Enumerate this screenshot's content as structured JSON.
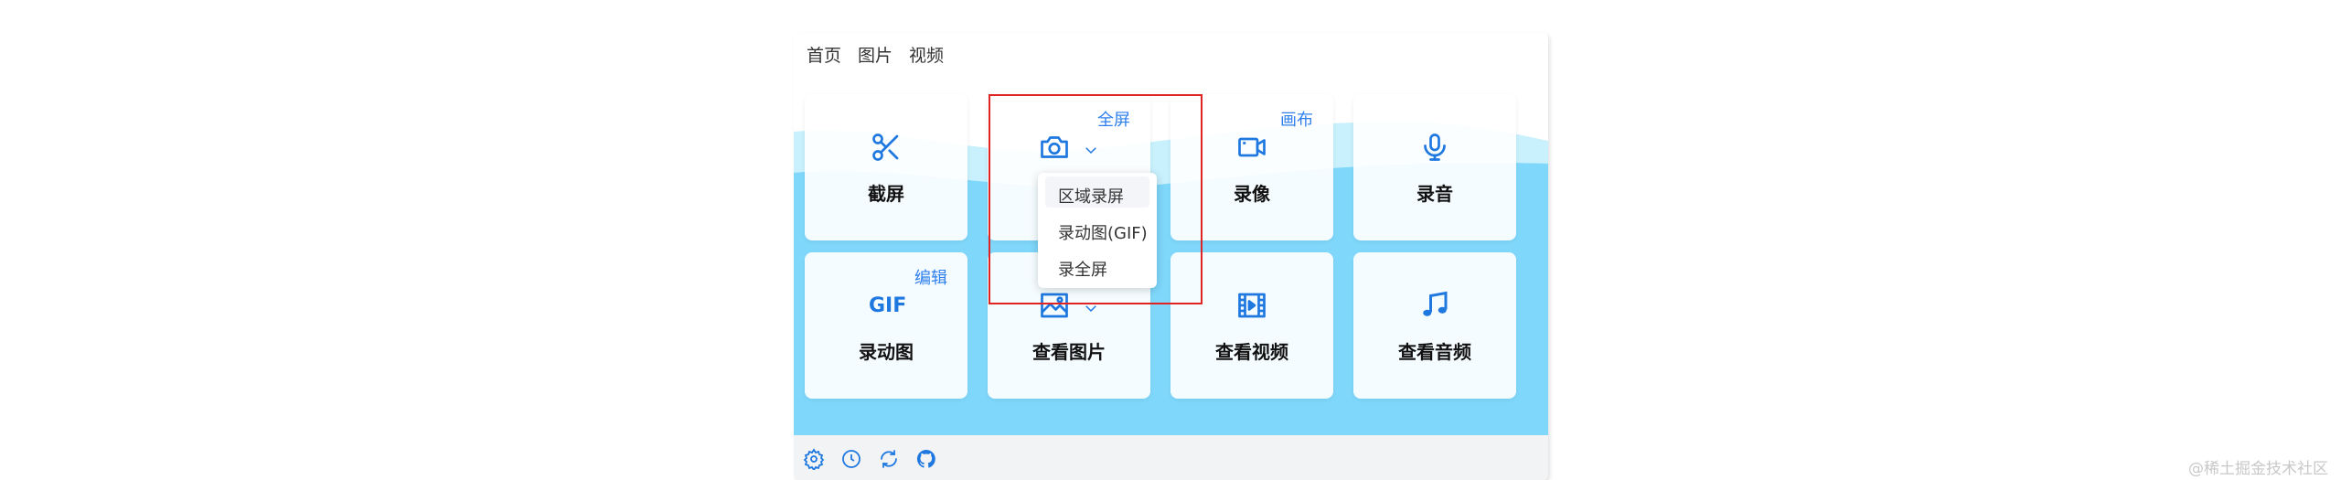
{
  "nav": {
    "items": [
      "首页",
      "图片",
      "视频"
    ]
  },
  "tiles": {
    "screenshot": {
      "label": "截屏",
      "icon": "scissors-icon"
    },
    "camera": {
      "tag": "全屏",
      "icon": "camera-icon"
    },
    "record": {
      "label": "录像",
      "tag": "画布",
      "icon": "video-camera-icon"
    },
    "audio": {
      "label": "录音",
      "icon": "microphone-icon"
    },
    "gif": {
      "label": "录动图",
      "tag": "编辑",
      "icon_text": "GIF"
    },
    "images": {
      "label": "查看图片",
      "icon": "image-icon"
    },
    "videos": {
      "label": "查看视频",
      "icon": "film-icon"
    },
    "music": {
      "label": "查看音频",
      "icon": "music-note-icon"
    }
  },
  "dropdown": {
    "items": [
      "区域录屏",
      "录动图(GIF)",
      "录全屏"
    ]
  },
  "footer": {
    "icons": [
      "gear-icon",
      "clock-icon",
      "refresh-icon",
      "github-icon"
    ]
  },
  "watermark": "@稀土掘金技术社区",
  "colors": {
    "accent": "#1f78e0",
    "wave": "#7fd8fb",
    "highlight": "#e02424"
  }
}
